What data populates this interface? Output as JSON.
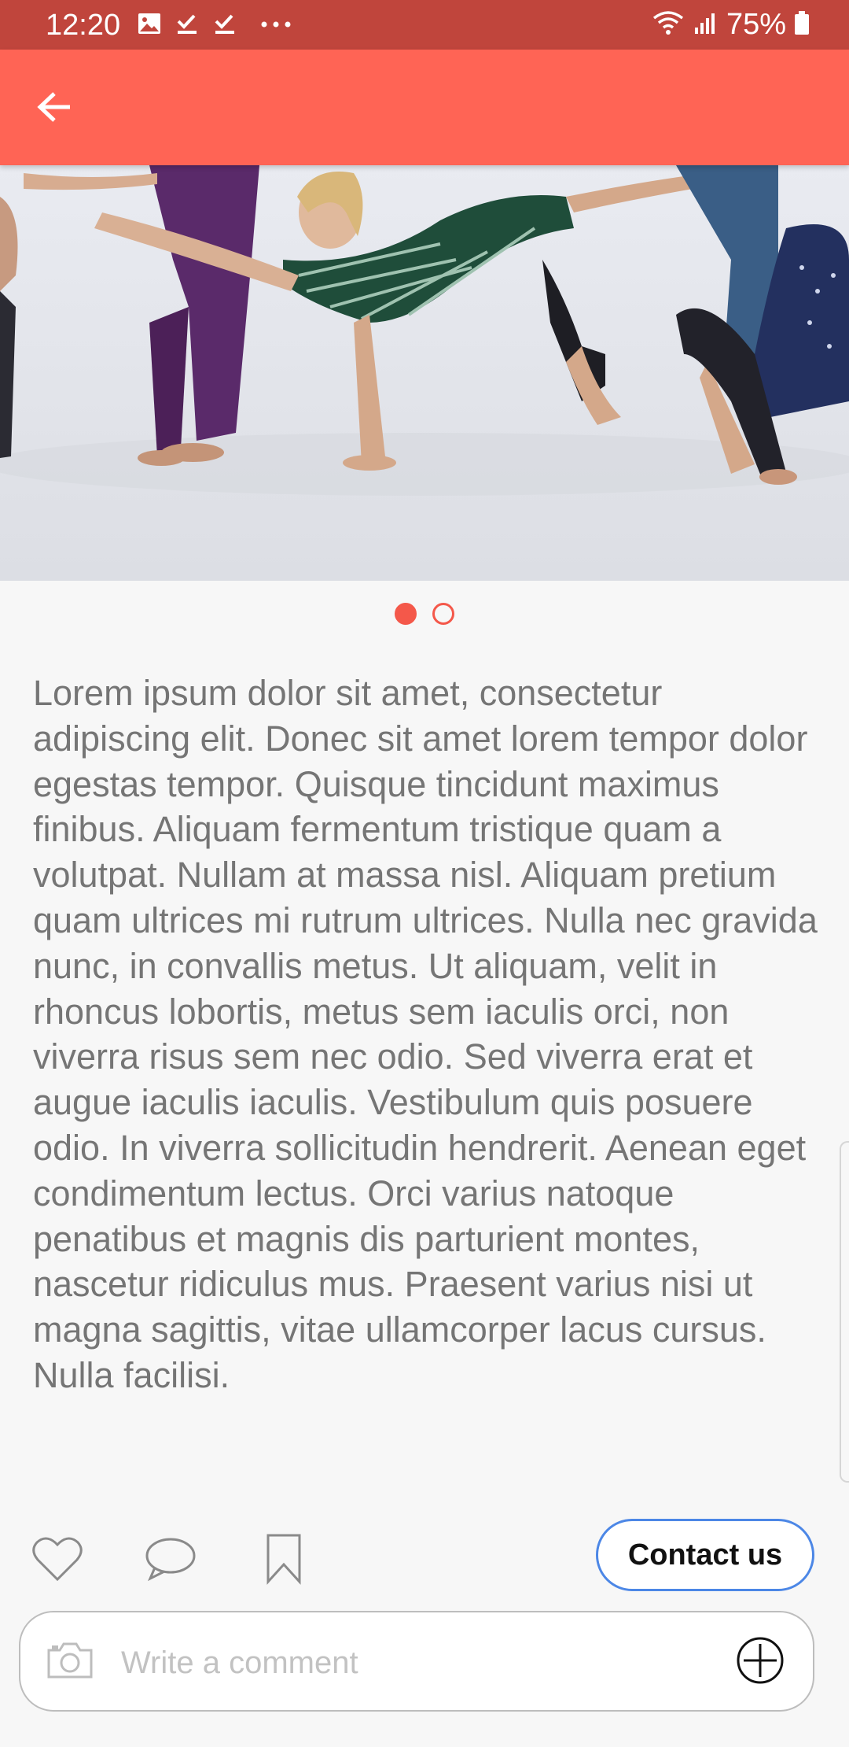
{
  "status_bar": {
    "time": "12:20",
    "battery": "75%",
    "left_icons": [
      "image-icon",
      "check-icon",
      "check-icon",
      "more-icon"
    ],
    "right_icons": [
      "wifi-icon",
      "signal-icon",
      "battery-icon"
    ],
    "color": "#c0453c"
  },
  "app_bar": {
    "back_icon": "arrow-left-icon",
    "color": "#ff6455"
  },
  "carousel": {
    "image_description": "dancers-photo",
    "pages": 2,
    "active_index": 0,
    "dot_color": "#f4584a"
  },
  "body": {
    "text": "Lorem ipsum dolor sit amet, consectetur adipiscing elit. Donec sit amet lorem tempor dolor egestas tempor. Quisque tincidunt maximus finibus. Aliquam fermentum tristique quam a volutpat. Nullam at massa nisl. Aliquam pretium quam ultrices mi rutrum ultrices. Nulla nec gravida nunc, in convallis metus. Ut aliquam, velit in rhoncus lobortis, metus sem iaculis orci, non viverra risus sem nec odio. Sed viverra erat et augue iaculis iaculis. Vestibulum quis posuere odio. In viverra sollicitudin hendrerit. Aenean eget condimentum lectus. Orci varius natoque penatibus et magnis dis parturient montes, nascetur ridiculus mus. Praesent varius nisi ut magna sagittis, vitae ullamcorper lacus cursus. Nulla facilisi."
  },
  "actions": {
    "icons": [
      "heart-icon",
      "comment-icon",
      "bookmark-icon"
    ],
    "contact_label": "Contact us",
    "contact_border_color": "#4c87e6"
  },
  "comment": {
    "placeholder": "Write a comment",
    "camera_icon": "camera-icon",
    "add_icon": "plus-circle-icon"
  }
}
